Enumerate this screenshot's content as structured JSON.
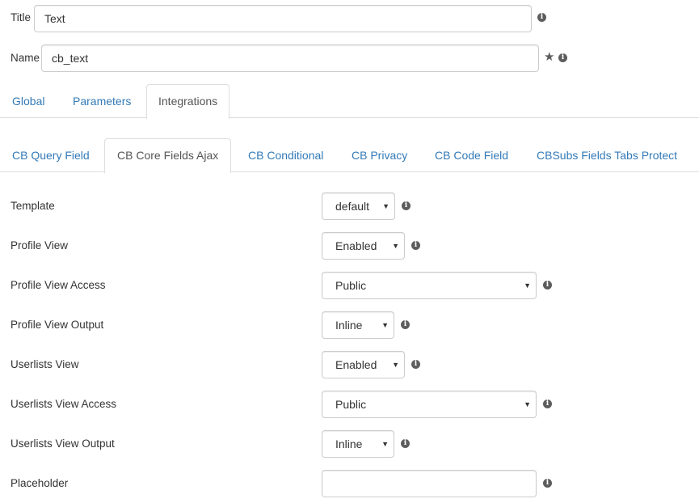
{
  "header": {
    "title_label": "Title",
    "title_value": "Text",
    "name_label": "Name",
    "name_value": "cb_text"
  },
  "main_tabs": [
    {
      "label": "Global",
      "active": false
    },
    {
      "label": "Parameters",
      "active": false
    },
    {
      "label": "Integrations",
      "active": true
    }
  ],
  "sub_tabs": [
    {
      "label": "CB Query Field",
      "active": false
    },
    {
      "label": "CB Core Fields Ajax",
      "active": true
    },
    {
      "label": "CB Conditional",
      "active": false
    },
    {
      "label": "CB Privacy",
      "active": false
    },
    {
      "label": "CB Code Field",
      "active": false
    },
    {
      "label": "CBSubs Fields Tabs Protect",
      "active": false
    }
  ],
  "icons": {
    "info": "info-circle-icon",
    "star": "star-icon",
    "caret": "caret-down-icon"
  },
  "colors": {
    "link": "#337ab7",
    "text": "#333333",
    "border": "#cccccc",
    "icon": "#5d5d5d"
  },
  "fields": [
    {
      "label": "Template",
      "value": "default",
      "type": "select"
    },
    {
      "label": "Profile View",
      "value": "Enabled",
      "type": "select"
    },
    {
      "label": "Profile View Access",
      "value": "Public",
      "type": "select"
    },
    {
      "label": "Profile View Output",
      "value": "Inline",
      "type": "select"
    },
    {
      "label": "Userlists View",
      "value": "Enabled",
      "type": "select"
    },
    {
      "label": "Userlists View Access",
      "value": "Public",
      "type": "select"
    },
    {
      "label": "Userlists View Output",
      "value": "Inline",
      "type": "select"
    },
    {
      "label": "Placeholder",
      "value": "",
      "type": "text"
    }
  ]
}
